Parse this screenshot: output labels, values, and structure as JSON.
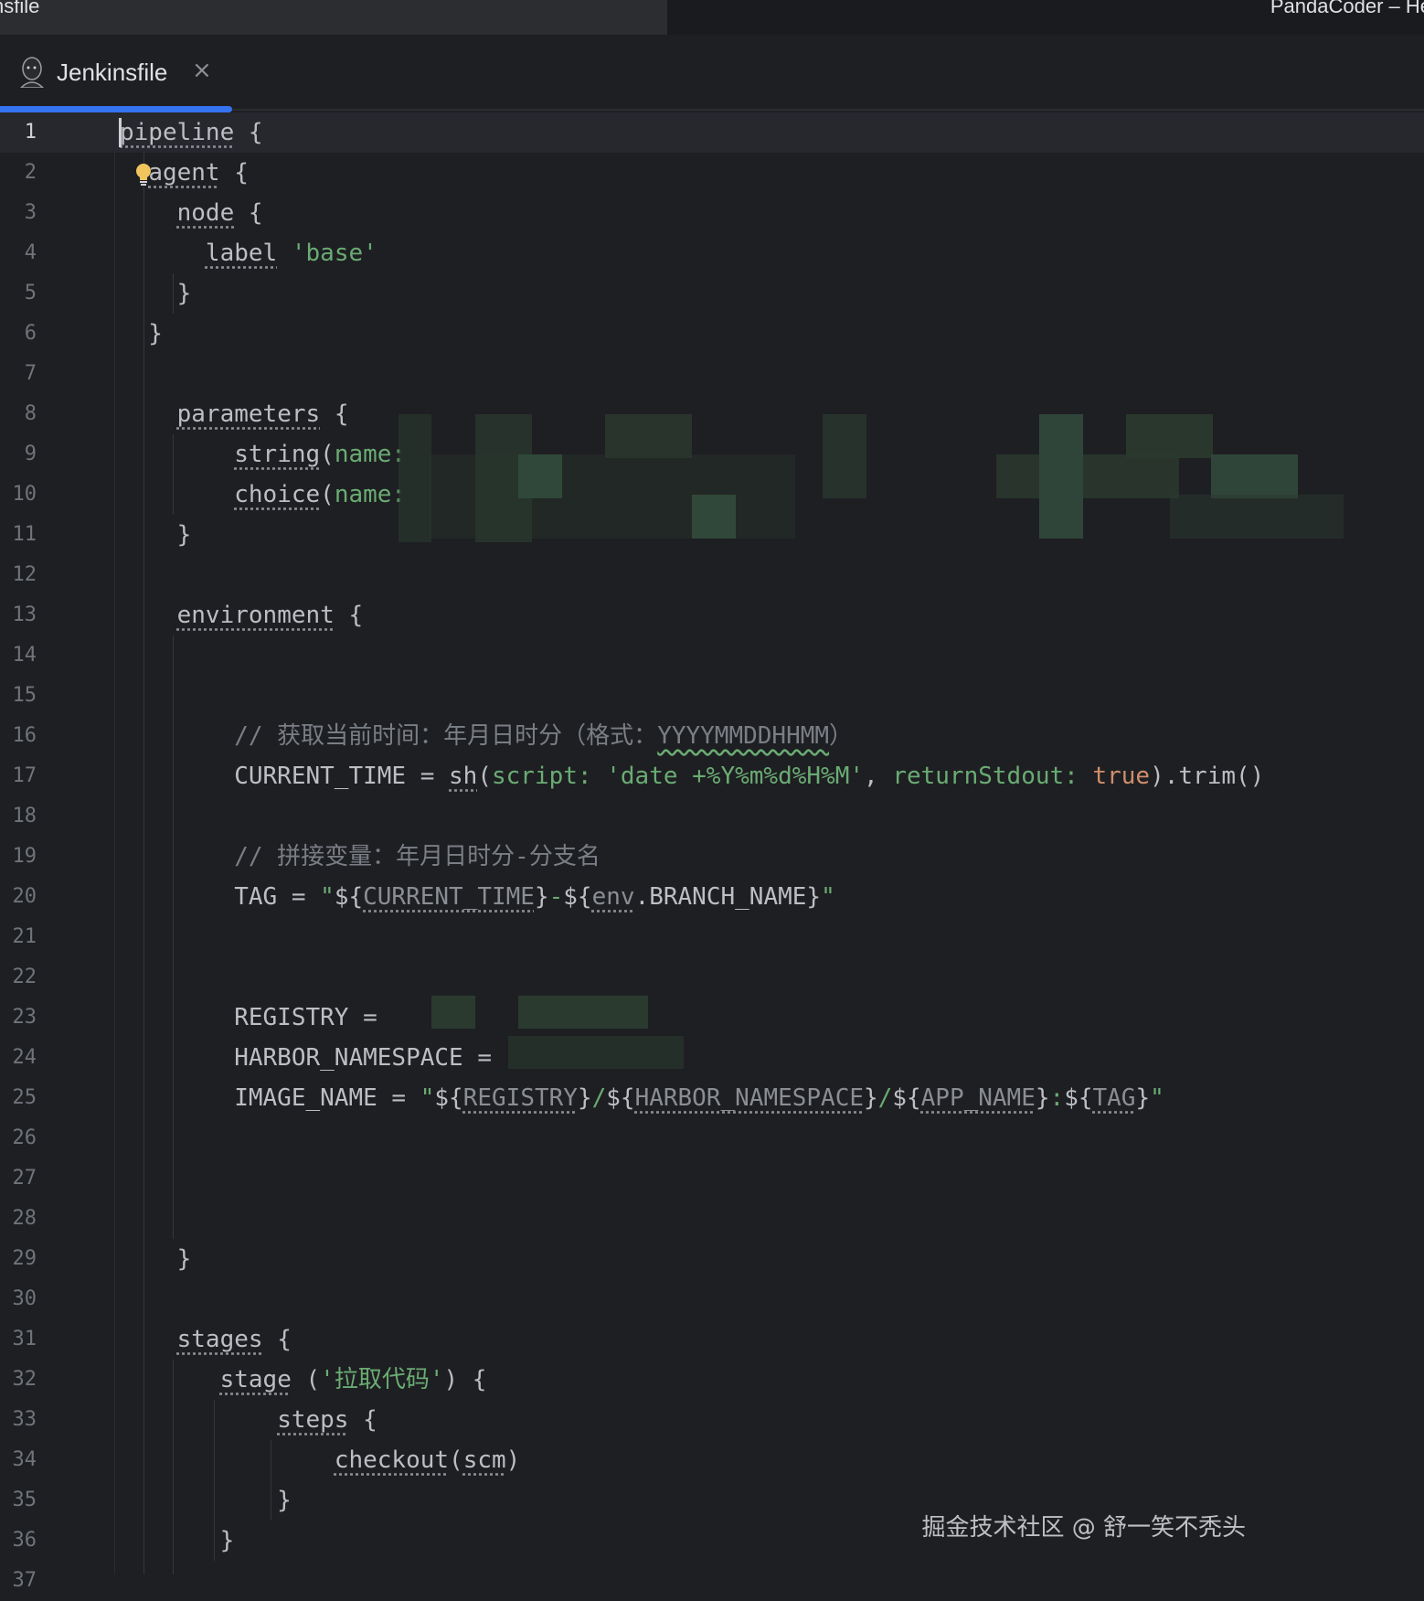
{
  "window": {
    "title_left": "nsfile",
    "title_right": "PandaCoder – He"
  },
  "tab": {
    "label": "Jenkinsfile",
    "close": "×"
  },
  "watermark": "掘金技术社区 @ 舒一笑不秃头",
  "current_line": 1,
  "lines": [
    [
      [
        "pipeline",
        "u"
      ],
      [
        " {",
        "p"
      ]
    ],
    [
      [
        "  ",
        "p"
      ],
      [
        "agent",
        "u"
      ],
      [
        " {",
        "p"
      ]
    ],
    [
      [
        "    ",
        "p"
      ],
      [
        "node",
        "u"
      ],
      [
        " {",
        "p"
      ]
    ],
    [
      [
        "      ",
        "p"
      ],
      [
        "label",
        "u"
      ],
      [
        " ",
        "p"
      ],
      [
        "'base'",
        "s"
      ]
    ],
    [
      [
        "    }",
        "p"
      ]
    ],
    [
      [
        "  }",
        "p"
      ]
    ],
    [],
    [
      [
        "    ",
        "p"
      ],
      [
        "parameters",
        "u"
      ],
      [
        " {",
        "p"
      ]
    ],
    [
      [
        "        ",
        "p"
      ],
      [
        "string",
        "u"
      ],
      [
        "(",
        "p"
      ],
      [
        "name:",
        "n"
      ]
    ],
    [
      [
        "        ",
        "p"
      ],
      [
        "choice",
        "u"
      ],
      [
        "(",
        "p"
      ],
      [
        "name:",
        "n"
      ]
    ],
    [
      [
        "    }",
        "p"
      ]
    ],
    [],
    [
      [
        "    ",
        "p"
      ],
      [
        "environment",
        "u"
      ],
      [
        " {",
        "p"
      ]
    ],
    [],
    [],
    [
      [
        "        // 获取当前时间：年月日时分（格式：",
        "c"
      ],
      [
        "YYYYMMDDHHMM",
        "w"
      ],
      [
        "）",
        "c"
      ]
    ],
    [
      [
        "        CURRENT_TIME = ",
        "p"
      ],
      [
        "sh",
        "u"
      ],
      [
        "(",
        "p"
      ],
      [
        "script: ",
        "n"
      ],
      [
        "'date +%Y%m%d%H%M'",
        "s"
      ],
      [
        ", ",
        "p"
      ],
      [
        "returnStdout: ",
        "n"
      ],
      [
        "true",
        "k"
      ],
      [
        ").trim()",
        "p"
      ]
    ],
    [],
    [
      [
        "        // 拼接变量：年月日时分-分支名",
        "c"
      ]
    ],
    [
      [
        "        TAG = ",
        "p"
      ],
      [
        "\"",
        "s"
      ],
      [
        "${",
        "p"
      ],
      [
        "CURRENT_TIME",
        "ui"
      ],
      [
        "}",
        "p"
      ],
      [
        "-",
        "s"
      ],
      [
        "${",
        "p"
      ],
      [
        "env",
        "ui"
      ],
      [
        ".BRANCH_NAME}",
        "p"
      ],
      [
        "\"",
        "s"
      ]
    ],
    [],
    [],
    [
      [
        "        REGISTRY = ",
        "p"
      ]
    ],
    [
      [
        "        HARBOR_NAMESPACE = ",
        "p"
      ]
    ],
    [
      [
        "        IMAGE_NAME = ",
        "p"
      ],
      [
        "\"",
        "s"
      ],
      [
        "${",
        "p"
      ],
      [
        "REGISTRY",
        "ui"
      ],
      [
        "}",
        "p"
      ],
      [
        "/",
        "s"
      ],
      [
        "${",
        "p"
      ],
      [
        "HARBOR_NAMESPACE",
        "ui"
      ],
      [
        "}",
        "p"
      ],
      [
        "/",
        "s"
      ],
      [
        "${",
        "p"
      ],
      [
        "APP_NAME",
        "ui"
      ],
      [
        "}",
        "p"
      ],
      [
        ":",
        "s"
      ],
      [
        "${",
        "p"
      ],
      [
        "TAG",
        "ui"
      ],
      [
        "}",
        "p"
      ],
      [
        "\"",
        "s"
      ]
    ],
    [],
    [],
    [],
    [
      [
        "    }",
        "p"
      ]
    ],
    [],
    [
      [
        "    ",
        "p"
      ],
      [
        "stages",
        "u"
      ],
      [
        " {",
        "p"
      ]
    ],
    [
      [
        "       ",
        "p"
      ],
      [
        "stage",
        "u"
      ],
      [
        " (",
        "p"
      ],
      [
        "'拉取代码'",
        "s"
      ],
      [
        ") {",
        "p"
      ]
    ],
    [
      [
        "           ",
        "p"
      ],
      [
        "steps",
        "u"
      ],
      [
        " {",
        "p"
      ]
    ],
    [
      [
        "               ",
        "p"
      ],
      [
        "checkout",
        "u"
      ],
      [
        "(",
        "p"
      ],
      [
        "scm",
        "u"
      ],
      [
        ")",
        "p"
      ]
    ],
    [
      [
        "           }",
        "p"
      ]
    ],
    [
      [
        "       }",
        "p"
      ]
    ],
    []
  ]
}
